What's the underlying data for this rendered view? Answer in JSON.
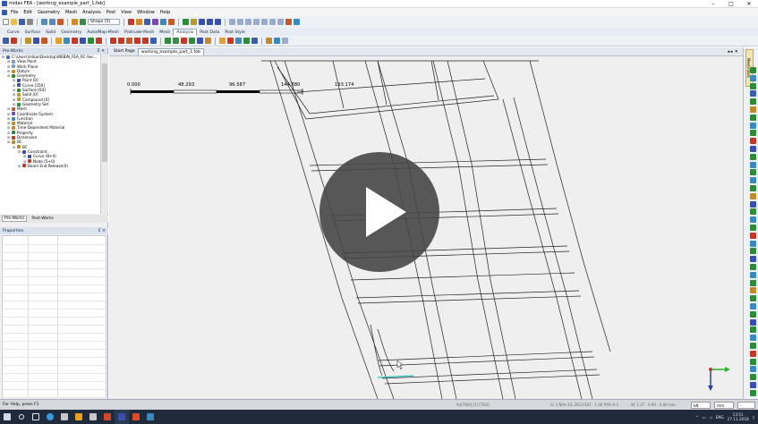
{
  "window": {
    "title": "midas FEA - [working_example_part_1.feb]"
  },
  "menu": [
    "File",
    "Edit",
    "Geometry",
    "Mesh",
    "Analysis",
    "Post",
    "View",
    "Window",
    "Help"
  ],
  "toolbar": {
    "shape_dropdown": "Shape [5]"
  },
  "ribbon_tabs": [
    {
      "label": "Curve",
      "active": false
    },
    {
      "label": "Surface",
      "active": false
    },
    {
      "label": "Solid",
      "active": false
    },
    {
      "label": "Geometry",
      "active": false
    },
    {
      "label": "Auto/Map-Mesh",
      "active": false
    },
    {
      "label": "Protrude-Mesh",
      "active": false
    },
    {
      "label": "Mesh",
      "active": false
    },
    {
      "label": "Analysis",
      "active": true
    },
    {
      "label": "Post Data",
      "active": false
    },
    {
      "label": "Post Style",
      "active": false
    }
  ],
  "works_panel": {
    "title": "Pre-Works",
    "tree": [
      {
        "label": "C:\\Users\\mikar\\Desktop\\WEBIN_FEA_RC-Sec...",
        "indent": 0,
        "color": "#4a6fb5"
      },
      {
        "label": "View Point",
        "indent": 1,
        "color": "#7a9cc8"
      },
      {
        "label": "Work Plane",
        "indent": 1,
        "color": "#7a9cc8"
      },
      {
        "label": "Datum",
        "indent": 1,
        "color": "#d08a2a"
      },
      {
        "label": "Geometry",
        "indent": 1,
        "color": "#2f8a3a"
      },
      {
        "label": "Point [0]",
        "indent": 2,
        "color": "#3a4fae"
      },
      {
        "label": "Curve [250]",
        "indent": 2,
        "color": "#3a4fae"
      },
      {
        "label": "Surface [64]",
        "indent": 2,
        "color": "#2f8a3a"
      },
      {
        "label": "Solid [0]",
        "indent": 2,
        "color": "#b89a2a"
      },
      {
        "label": "Compound [0]",
        "indent": 2,
        "color": "#b89a2a"
      },
      {
        "label": "Geometry Set",
        "indent": 2,
        "color": "#2f8a3a"
      },
      {
        "label": "Mesh",
        "indent": 1,
        "color": "#c05a2a"
      },
      {
        "label": "Coordinate System",
        "indent": 1,
        "color": "#7a4ab0"
      },
      {
        "label": "Function",
        "indent": 1,
        "color": "#3a8ac0"
      },
      {
        "label": "Material",
        "indent": 1,
        "color": "#c08a2a"
      },
      {
        "label": "Time-Dependent Material",
        "indent": 1,
        "color": "#c08a2a"
      },
      {
        "label": "Property",
        "indent": 1,
        "color": "#2f8a3a"
      },
      {
        "label": "Dimension",
        "indent": 1,
        "color": "#c03a2a"
      },
      {
        "label": "BC",
        "indent": 1,
        "color": "#c08a2a"
      },
      {
        "label": "BC",
        "indent": 2,
        "color": "#c08a2a"
      },
      {
        "label": "Constraint",
        "indent": 3,
        "color": "#3a4fae"
      },
      {
        "label": "Curve (8+4)",
        "indent": 4,
        "color": "#3a4fae"
      },
      {
        "label": "Node (5+0)",
        "indent": 4,
        "color": "#c03a2a"
      },
      {
        "label": "Beam End Release(0)",
        "indent": 3,
        "color": "#c03a2a"
      }
    ],
    "tabs": [
      {
        "label": "Pre-Works",
        "active": true
      },
      {
        "label": "Post-Works",
        "active": false
      }
    ]
  },
  "properties_panel": {
    "title": "Properties"
  },
  "doc_tabs": [
    {
      "label": "Start Page",
      "active": false
    },
    {
      "label": "working_example_part_1.feb",
      "active": true
    }
  ],
  "ruler": {
    "labels": [
      "0.000",
      "48.293",
      "96.587",
      "144.880",
      "193.174"
    ]
  },
  "right_tab": "Mesh/Tools",
  "status": {
    "help": "For Help, press F1",
    "mid1": "Ax[78/0]·[1] [TGA]",
    "mid2": "G: 1 N/m 2/L 3021/301 · 1.00 P/fm·0.1",
    "mid3": "W: 1.37 · 0.90 · 0.00 mm",
    "unit_force": "kN",
    "unit_length": "mm",
    "unit_other": "-"
  },
  "taskbar": {
    "lang": "ENG",
    "time": "13:51",
    "date": "27.11.2018"
  },
  "colors": {
    "accent": "#2a5caa",
    "viewport_bg": "#efefef",
    "play_overlay": "#464646"
  }
}
